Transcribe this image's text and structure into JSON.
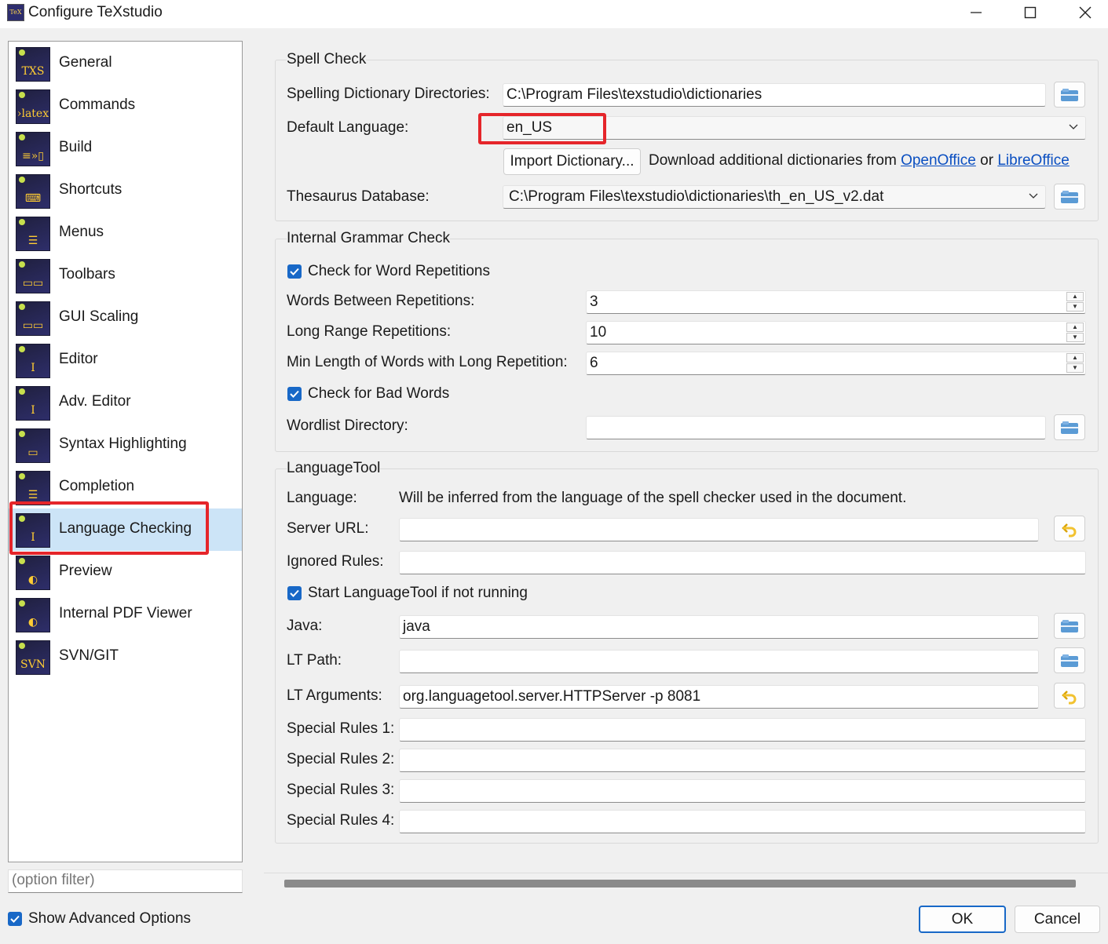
{
  "window": {
    "title": "Configure TeXstudio",
    "app_icon_text": "TeX",
    "controls": {
      "minimize": "minimize-icon",
      "maximize": "maximize-icon",
      "close": "close-icon"
    }
  },
  "sidebar": {
    "items": [
      {
        "label": "General",
        "icon": "txs-icon",
        "glyph": "TXS"
      },
      {
        "label": "Commands",
        "icon": "latex-icon",
        "glyph": "›latex"
      },
      {
        "label": "Build",
        "icon": "build-icon",
        "glyph": "≡»▯"
      },
      {
        "label": "Shortcuts",
        "icon": "keyboard-icon",
        "glyph": "⌨"
      },
      {
        "label": "Menus",
        "icon": "menu-icon",
        "glyph": "☰"
      },
      {
        "label": "Toolbars",
        "icon": "toolbar-icon",
        "glyph": "▭▭"
      },
      {
        "label": "GUI Scaling",
        "icon": "scaling-icon",
        "glyph": "▭▭"
      },
      {
        "label": "Editor",
        "icon": "editor-icon",
        "glyph": "I"
      },
      {
        "label": "Adv. Editor",
        "icon": "adv-editor-icon",
        "glyph": "I"
      },
      {
        "label": "Syntax Highlighting",
        "icon": "syntax-icon",
        "glyph": "▭"
      },
      {
        "label": "Completion",
        "icon": "completion-icon",
        "glyph": "☰"
      },
      {
        "label": "Language Checking",
        "icon": "language-icon",
        "glyph": "I"
      },
      {
        "label": "Preview",
        "icon": "preview-icon",
        "glyph": "◐"
      },
      {
        "label": "Internal PDF Viewer",
        "icon": "pdf-viewer-icon",
        "glyph": "◐"
      },
      {
        "label": "SVN/GIT",
        "icon": "svn-icon",
        "glyph": "SVN"
      }
    ],
    "selected_index": 11,
    "filter_placeholder": "(option filter)",
    "show_advanced_label": "Show Advanced Options",
    "show_advanced_checked": true
  },
  "spell_check": {
    "title": "Spell Check",
    "dict_dirs_label": "Spelling Dictionary Directories:",
    "dict_dirs_value": "C:\\Program Files\\texstudio\\dictionaries",
    "default_language_label": "Default Language:",
    "default_language_value": "en_US",
    "import_button": "Import Dictionary...",
    "download_text": "Download additional dictionaries from",
    "link_openoffice": "OpenOffice",
    "or_text": "or",
    "link_libreoffice": "LibreOffice",
    "thesaurus_label": "Thesaurus Database:",
    "thesaurus_value": "C:\\Program Files\\texstudio\\dictionaries\\th_en_US_v2.dat"
  },
  "grammar": {
    "title": "Internal Grammar Check",
    "check_repetitions_label": "Check for Word Repetitions",
    "check_repetitions_checked": true,
    "words_between_label": "Words Between Repetitions:",
    "words_between_value": "3",
    "long_range_label": "Long Range Repetitions:",
    "long_range_value": "10",
    "min_length_label": "Min Length of Words with Long Repetition:",
    "min_length_value": "6",
    "bad_words_label": "Check for Bad Words",
    "bad_words_checked": true,
    "wordlist_label": "Wordlist Directory:",
    "wordlist_value": ""
  },
  "languagetool": {
    "title": "LanguageTool",
    "language_label": "Language:",
    "language_note": "Will be inferred from the language of the spell checker used in the document.",
    "server_url_label": "Server URL:",
    "server_url_value": "",
    "ignored_rules_label": "Ignored Rules:",
    "ignored_rules_value": "",
    "start_lt_label": "Start LanguageTool if not running",
    "start_lt_checked": true,
    "java_label": "Java:",
    "java_value": "java",
    "lt_path_label": "LT Path:",
    "lt_path_value": "",
    "lt_args_label": "LT Arguments:",
    "lt_args_value": "org.languagetool.server.HTTPServer -p 8081",
    "special_rules": [
      {
        "label": "Special Rules 1:",
        "value": ""
      },
      {
        "label": "Special Rules 2:",
        "value": ""
      },
      {
        "label": "Special Rules 3:",
        "value": ""
      },
      {
        "label": "Special Rules 4:",
        "value": ""
      }
    ]
  },
  "dialog_buttons": {
    "ok": "OK",
    "cancel": "Cancel"
  },
  "colors": {
    "accent": "#1868c7",
    "selection": "#cce4f7",
    "highlight_box": "#e5252a",
    "link": "#0b4fc1"
  }
}
